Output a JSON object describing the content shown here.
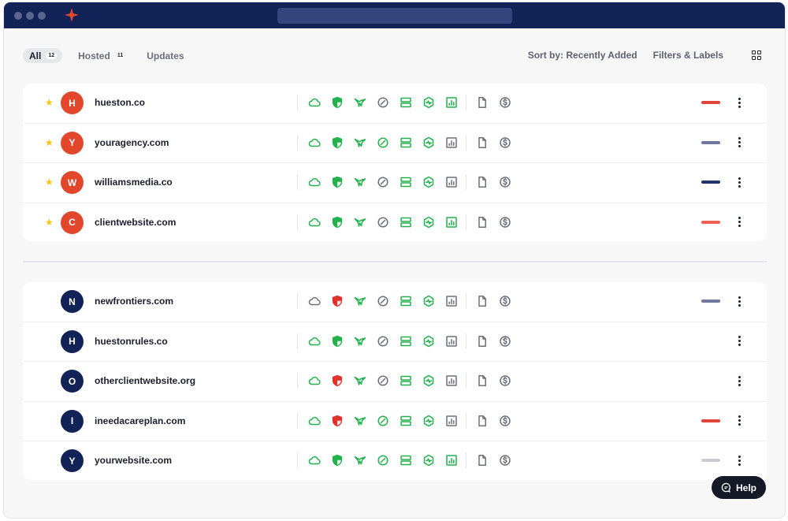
{
  "tabs": [
    {
      "label": "All",
      "count": "12",
      "active": true
    },
    {
      "label": "Hosted",
      "count": "11",
      "active": false
    },
    {
      "label": "Updates",
      "count": "",
      "active": false
    }
  ],
  "toolbar": {
    "sort_label": "Sort by: Recently Added",
    "filters_label": "Filters & Labels"
  },
  "colors": {
    "green": "#22b14c",
    "red": "#e0332d",
    "gray": "#6b6f7b",
    "navy": "#122457",
    "orange_avatar": "#e2472b"
  },
  "pinned_sites": [
    {
      "initial": "H",
      "name": "hueston.co",
      "starred": true,
      "avatar_color": "#e2472b",
      "status": [
        "green",
        "green",
        "green",
        "gray",
        "green",
        "green",
        "green",
        "gray",
        "gray"
      ],
      "label_color": "#e0433a"
    },
    {
      "initial": "Y",
      "name": "youragency.com",
      "starred": true,
      "avatar_color": "#e2472b",
      "status": [
        "green",
        "green",
        "green",
        "green",
        "green",
        "green",
        "gray",
        "gray",
        "gray"
      ],
      "label_color": "#7078a0"
    },
    {
      "initial": "W",
      "name": "williamsmedia.co",
      "starred": true,
      "avatar_color": "#e2472b",
      "status": [
        "green",
        "green",
        "green",
        "gray",
        "green",
        "green",
        "gray",
        "gray",
        "gray"
      ],
      "label_color": "#23346b"
    },
    {
      "initial": "C",
      "name": "clientwebsite.com",
      "starred": true,
      "avatar_color": "#e2472b",
      "status": [
        "green",
        "green",
        "green",
        "gray",
        "green",
        "green",
        "green",
        "gray",
        "gray"
      ],
      "label_color": "#ee5f55"
    }
  ],
  "other_sites": [
    {
      "initial": "N",
      "name": "newfrontiers.com",
      "starred": false,
      "avatar_color": "#122457",
      "status": [
        "gray",
        "red",
        "green",
        "gray",
        "green",
        "green",
        "gray",
        "gray",
        "gray"
      ],
      "label_color": "#7078a0"
    },
    {
      "initial": "H",
      "name": "huestonrules.co",
      "starred": false,
      "avatar_color": "#122457",
      "status": [
        "green",
        "green",
        "green",
        "gray",
        "green",
        "green",
        "gray",
        "gray",
        "gray"
      ],
      "label_color": ""
    },
    {
      "initial": "O",
      "name": "otherclientwebsite.org",
      "starred": false,
      "avatar_color": "#122457",
      "status": [
        "green",
        "red",
        "green",
        "gray",
        "green",
        "green",
        "gray",
        "gray",
        "gray"
      ],
      "label_color": ""
    },
    {
      "initial": "I",
      "name": "ineedacareplan.com",
      "starred": false,
      "avatar_color": "#122457",
      "status": [
        "green",
        "red",
        "green",
        "green",
        "green",
        "green",
        "gray",
        "gray",
        "gray"
      ],
      "label_color": "#e0433a"
    },
    {
      "initial": "Y",
      "name": "yourwebsite.com",
      "starred": false,
      "avatar_color": "#122457",
      "status": [
        "green",
        "green",
        "green",
        "green",
        "green",
        "green",
        "green",
        "gray",
        "gray"
      ],
      "label_color": "#c9cbd1"
    }
  ],
  "status_icons": [
    "cloud-icon",
    "shield-icon",
    "hummingbird-icon",
    "speed-icon",
    "server-icon",
    "security-hex-icon",
    "analytics-icon",
    "document-icon",
    "dollar-icon"
  ],
  "help": {
    "label": "Help"
  }
}
